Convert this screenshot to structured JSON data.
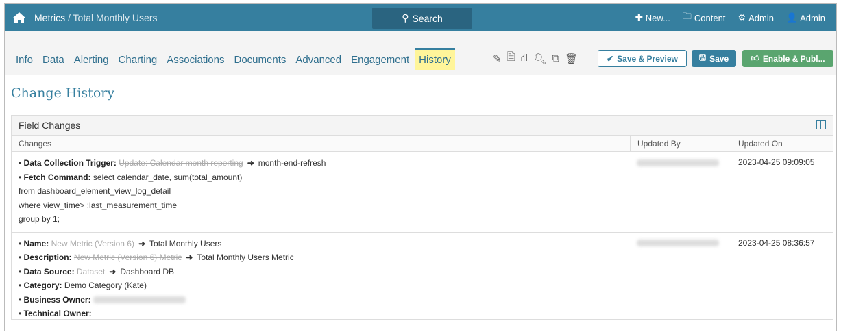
{
  "header": {
    "crumb_root": "Metrics",
    "crumb_sep": " / ",
    "crumb_current": "Total Monthly Users",
    "search": "Search",
    "new": "New...",
    "content": "Content",
    "admin_settings": "Admin",
    "admin_user": "Admin"
  },
  "tabs": [
    "Info",
    "Data",
    "Alerting",
    "Charting",
    "Associations",
    "Documents",
    "Advanced",
    "Engagement",
    "History"
  ],
  "buttons": {
    "save_preview": "Save & Preview",
    "save": "Save",
    "enable": "Enable & Publ..."
  },
  "page_title": "Change History",
  "panel": {
    "title": "Field Changes",
    "columns": [
      "Changes",
      "Updated By",
      "Updated On"
    ]
  },
  "rows": [
    {
      "updated_on": "2023-04-25 09:09:05",
      "trigger_label": "Data Collection Trigger:",
      "trigger_old": "Update: Calendar month reporting",
      "trigger_new": "month-end-refresh",
      "fetch_label": "Fetch Command:",
      "fetch_lines": [
        "select calendar_date, sum(total_amount)",
        "from dashboard_element_view_log_detail",
        "where view_time> :last_measurement_time",
        "group by 1;"
      ]
    },
    {
      "updated_on": "2023-04-25 08:36:57",
      "name_label": "Name:",
      "name_old": "New Metric (Version 6)",
      "name_new": "Total Monthly Users",
      "desc_label": "Description:",
      "desc_old": "New Metric (Version 6) Metric",
      "desc_new": "Total Monthly Users Metric",
      "ds_label": "Data Source:",
      "ds_old": "Dataset",
      "ds_new": "Dashboard DB",
      "cat_label": "Category:",
      "cat_value": "Demo Category (Kate)",
      "bo_label": "Business Owner:",
      "to_label": "Technical Owner:"
    }
  ],
  "bullet": "• ",
  "arrow": "➜"
}
